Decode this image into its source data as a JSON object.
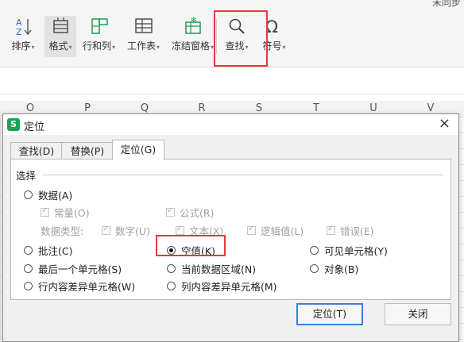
{
  "ribbon": {
    "sync_status": "未同步",
    "sort_label": "排序",
    "format_label": "格式",
    "rowcol_label": "行和列",
    "sheet_label": "工作表",
    "freeze_label": "冻结窗格",
    "find_label": "查找",
    "symbol_label": "符号"
  },
  "columns": [
    "O",
    "P",
    "Q",
    "R",
    "S",
    "T",
    "U",
    "V"
  ],
  "dialog": {
    "title": "定位",
    "close": "×",
    "tabs": [
      "查找(D)",
      "替换(P)",
      "定位(G)"
    ],
    "group_title": "选择",
    "options": {
      "data": "数据(A)",
      "constant": "常量(O)",
      "formula": "公式(R)",
      "data_type": "数据类型:",
      "number": "数字(U)",
      "text": "文本(X)",
      "logic": "逻辑值(L)",
      "error": "错误(E)",
      "comment": "批注(C)",
      "blank": "空值(K)",
      "visible": "可见单元格(Y)",
      "last_cell": "最后一个单元格(S)",
      "current_region": "当前数据区域(N)",
      "object": "对象(B)",
      "row_diff": "行内容差异单元格(W)",
      "col_diff": "列内容差异单元格(M)"
    },
    "selected_option": "空值(K)",
    "buttons": {
      "locate": "定位(T)",
      "close": "关闭"
    }
  },
  "colors": {
    "highlight": "#e23b3b",
    "logo": "#1aa25a",
    "primary_border": "#3c7fd6"
  }
}
